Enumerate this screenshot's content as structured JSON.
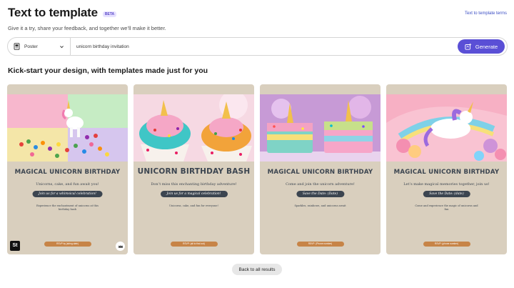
{
  "header": {
    "title": "Text to template",
    "badge": "BETA",
    "terms_link": "Text to template terms",
    "subtitle": "Give it a try, share your feedback, and together we’ll make it better."
  },
  "prompt": {
    "format": "Poster",
    "value": "unicorn birthday invitation",
    "generate_label": "Generate"
  },
  "section": {
    "title": "Kick-start your design, with templates made just for you"
  },
  "cards": [
    {
      "title": "MAGICAL UNICORN BIRTHDAY",
      "line1": "Unicorns, cake, and fun await you!",
      "pill": "Join us for a whimsical celebration!",
      "line2": "Experience the enchantment of unicorns at this birthday bash",
      "rsvp": "RSVP by (string date)",
      "badge": "St"
    },
    {
      "title": "UNICORN BIRTHDAY BASH",
      "line1": "Don’t miss this enchanting birthday adventure!",
      "pill": "Join us for a magical celebration!",
      "line2": "Unicorns, cake, and fun for everyone!",
      "rsvp": "RSVP: (all to find out)"
    },
    {
      "title": "MAGICAL UNICORN BIRTHDAY",
      "line1": "Come and join the unicorn adventure!",
      "pill": "Save the Date: (Date)",
      "line2": "Sparkles, rainbows, and unicorns await",
      "rsvp": "RSVP: (Phone number)"
    },
    {
      "title": "MAGICAL UNICORN BIRTHDAY",
      "line1": "Let’s make magical memories together, join us!",
      "pill": "Save the Date: (date)",
      "line2": "Come and experience the magic of unicorns and fun",
      "rsvp": "RSVP: (phone number)"
    }
  ],
  "back_button": "Back to all results",
  "colors": {
    "accent": "#5a4fd6",
    "card_bg": "#d9cfbe",
    "text_dark": "#3c4550",
    "rsvp": "#c78447"
  }
}
